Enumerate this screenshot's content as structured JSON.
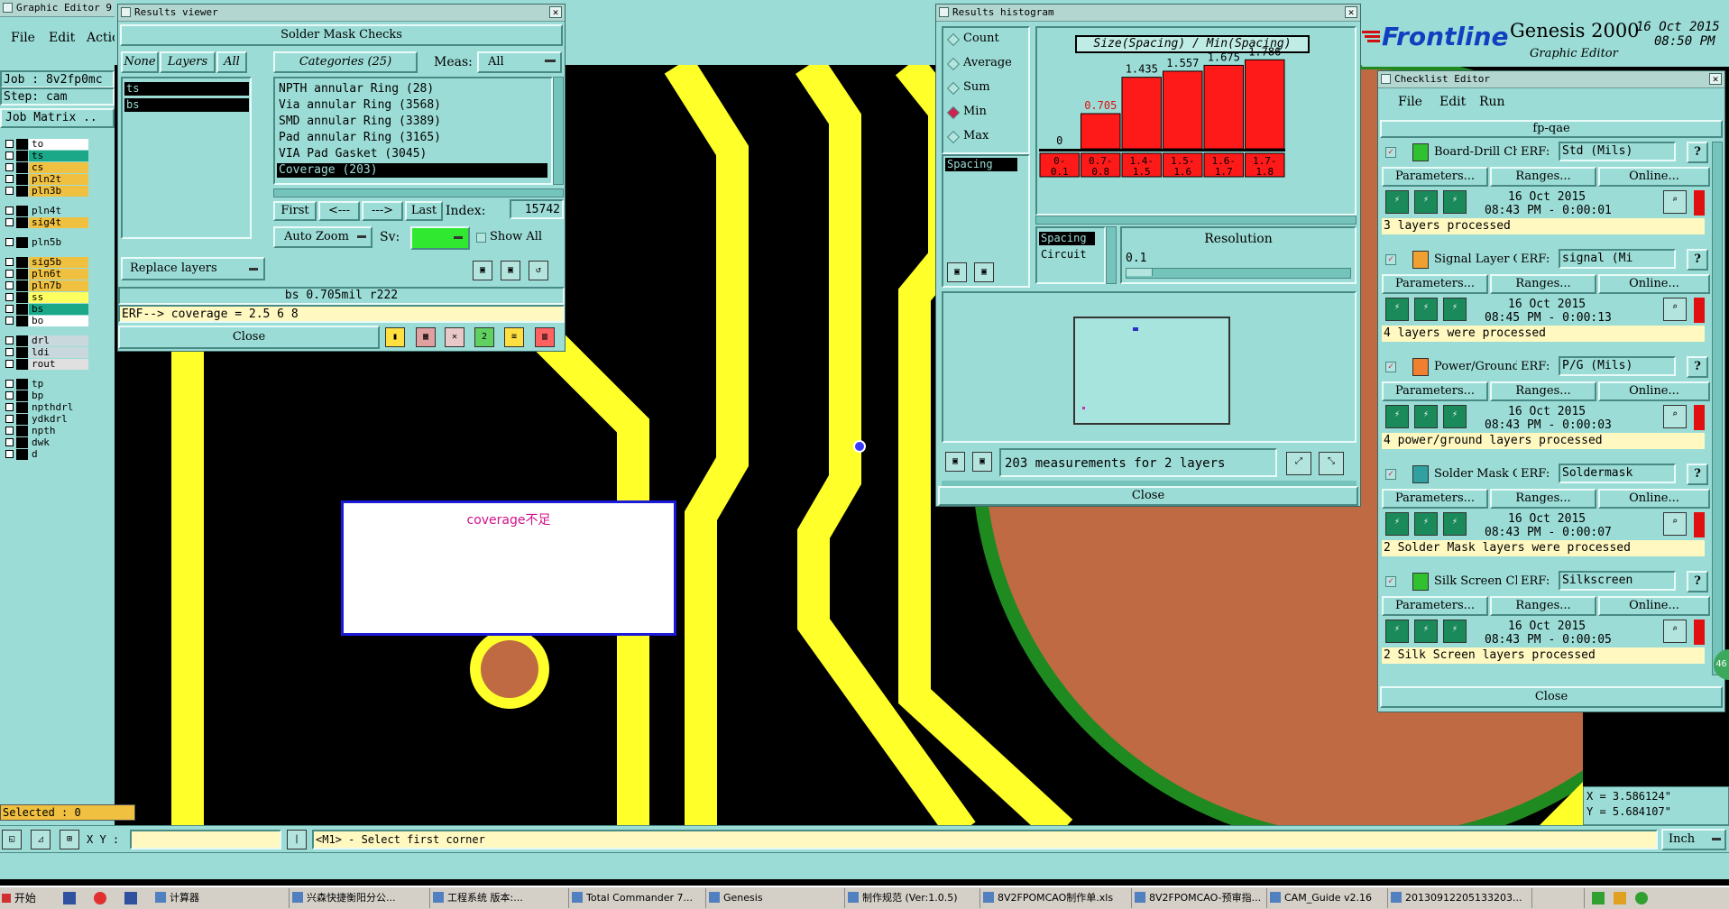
{
  "graphic_editor": {
    "title": "Graphic Editor 9",
    "menu": [
      "File",
      "Edit",
      "Actio"
    ],
    "job": "Job : 8v2fp0mc",
    "step": "Step: cam",
    "job_matrix": "Job Matrix ..",
    "layers": [
      {
        "name": "to",
        "color": "#ffffff"
      },
      {
        "name": "ts",
        "color": "#1aa888"
      },
      {
        "name": "cs",
        "color": "#f0c040"
      },
      {
        "name": "pln2t",
        "color": "#f0c040"
      },
      {
        "name": "pln3b",
        "color": "#f0c040"
      },
      {
        "name": "pln4t",
        "color": "#9cdcd6"
      },
      {
        "name": "sig4t",
        "color": "#f0c040"
      },
      {
        "name": "pln5b",
        "color": "#9cdcd6"
      },
      {
        "name": "sig5b",
        "color": "#f0c040"
      },
      {
        "name": "pln6t",
        "color": "#f0c040"
      },
      {
        "name": "pln7b",
        "color": "#f0c040"
      },
      {
        "name": "ss",
        "color": "#ffff60"
      },
      {
        "name": "bs",
        "color": "#1aa888"
      },
      {
        "name": "bo",
        "color": "#ffffff"
      },
      {
        "name": "drl",
        "color": "#c8d8dc"
      },
      {
        "name": "ldi",
        "color": "#c8d8dc"
      },
      {
        "name": "rout",
        "color": "#e0e0e0"
      },
      {
        "name": "tp",
        "color": "#9cdcd6"
      },
      {
        "name": "bp",
        "color": "#9cdcd6"
      },
      {
        "name": "npthdrl",
        "color": "#9cdcd6"
      },
      {
        "name": "ydkdrl",
        "color": "#9cdcd6"
      },
      {
        "name": "npth",
        "color": "#9cdcd6"
      },
      {
        "name": "dwk",
        "color": "#9cdcd6"
      },
      {
        "name": "d",
        "color": "#9cdcd6"
      }
    ],
    "selected": "Selected : 0",
    "xy_label": "X Y :",
    "xy_value": "",
    "prompt": "<M1> - Select first corner",
    "units": "Inch",
    "coord_x": "X = 3.586124\"",
    "coord_y": "Y = 5.684107\"",
    "annotation": "coverage不足"
  },
  "results_viewer": {
    "title": "Results viewer",
    "header": "Solder Mask Checks",
    "none_btn": "None",
    "layers_btn": "Layers",
    "all_btn": "All",
    "layer_list": [
      "ts",
      "bs"
    ],
    "categories_label": "Categories (25)",
    "meas_label": "Meas:",
    "meas_value": "All",
    "categories": [
      "NPTH annular Ring (28)",
      "Via annular Ring (3568)",
      "SMD annular Ring (3389)",
      "Pad annular Ring (3165)",
      "VIA Pad Gasket (3045)",
      "Coverage (203)"
    ],
    "first": "First",
    "prev": "<---",
    "next": "--->",
    "last": "Last",
    "index_label": "Index:",
    "index_value": "15742",
    "auto_zoom": "Auto Zoom",
    "sv_label": "Sv:",
    "show_all": "Show All",
    "replace_layers": "Replace layers",
    "measure_line": "bs 0.705mil   r222",
    "erf_line": "ERF--> coverage = 2.5 6 8",
    "close": "Close"
  },
  "histogram": {
    "title": "Results histogram",
    "options": [
      "Count",
      "Average",
      "Sum",
      "Min",
      "Max"
    ],
    "selected_option": "Min",
    "list_item": "Spacing",
    "chart_title": "Size(Spacing) / Min(Spacing)",
    "spacing_label": "Spacing",
    "circuit_label": "Circuit",
    "resolution_label": "Resolution",
    "resolution_value": "0.1",
    "measurements": "203 measurements for 2 layers",
    "close": "Close"
  },
  "chart_data": {
    "type": "bar",
    "title": "Size(Spacing) / Min(Spacing)",
    "categories": [
      "0-0.1",
      "0.7-0.8",
      "1.4-1.5",
      "1.5-1.6",
      "1.6-1.7",
      "1.7-1.8"
    ],
    "values": [
      0,
      0.705,
      1.435,
      1.557,
      1.675,
      1.786
    ],
    "value_labels": [
      "0",
      "0.705",
      "1.435",
      "1.557",
      "1.675",
      "1.786"
    ],
    "ylim": [
      0,
      1.9
    ],
    "grid": false,
    "bar_color": "#ff1a1a"
  },
  "branding": {
    "logo": "Frontline",
    "product": "Genesis 2000",
    "subtitle": "Graphic Editor",
    "date": "16 Oct 2015",
    "time": "08:50 PM"
  },
  "checklist": {
    "title": "Checklist Editor",
    "menu": [
      "File",
      "Edit",
      "Run"
    ],
    "name": "fp-qae",
    "erf_label": "ERF:",
    "params_label": "Parameters...",
    "ranges_label": "Ranges...",
    "online_label": "Online...",
    "close": "Close",
    "checks": [
      {
        "name": "Board-Drill Che",
        "erf": "Std (Mils)",
        "date": "16 Oct 2015",
        "time": "08:43 PM - 0:00:01",
        "status": "3 layers processed"
      },
      {
        "name": "Signal Layer Ch",
        "erf": "signal (Mi",
        "date": "16 Oct 2015",
        "time": "08:45 PM - 0:00:13",
        "status": "4 layers were processed"
      },
      {
        "name": "Power/Ground C",
        "erf": "P/G (Mils)",
        "date": "16 Oct 2015",
        "time": "08:43 PM - 0:00:03",
        "status": "4 power/ground layers processed"
      },
      {
        "name": "Solder Mask Ch",
        "erf": "Soldermask",
        "date": "16 Oct 2015",
        "time": "08:43 PM - 0:00:07",
        "status": "2 Solder Mask layers were processed"
      },
      {
        "name": "Silk Screen Che",
        "erf": "Silkscreen",
        "date": "16 Oct 2015",
        "time": "08:43 PM - 0:00:05",
        "status": "2 Silk Screen layers processed"
      }
    ]
  },
  "taskbar": {
    "start": "开始",
    "items": [
      "计算器",
      "兴森快捷衡阳分公...",
      "工程系统  版本:...",
      "Total Commander 7...",
      "Genesis",
      "制作规范 (Ver:1.0.5)",
      "8V2FPOMCAO制作单.xls",
      "8V2FPOMCAO-预审指...",
      "CAM_Guide v2.16",
      "20130912205133203..."
    ],
    "badge": "46"
  }
}
